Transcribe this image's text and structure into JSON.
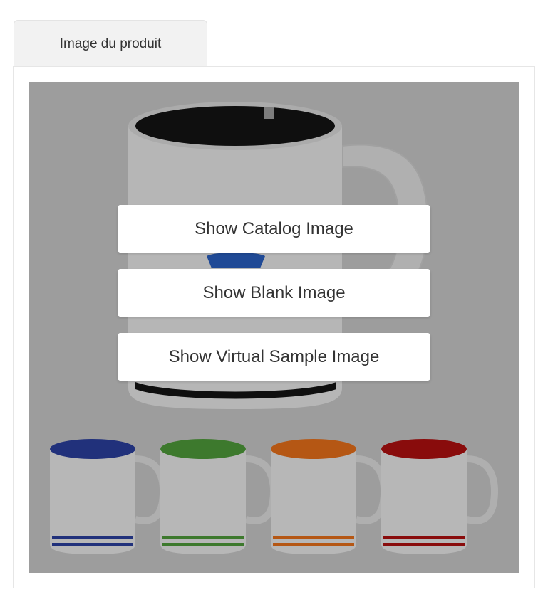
{
  "tab": {
    "label": "Image du produit"
  },
  "buttons": {
    "catalog": "Show Catalog Image",
    "blank": "Show Blank Image",
    "virtual": "Show Virtual Sample Image"
  },
  "colors": {
    "mug_body": "#e6e6e6",
    "main_interior": "#111111",
    "logo": "#2a5fc0",
    "variant_blue": "#2b3f9e",
    "variant_green": "#4f9b3a",
    "variant_orange": "#e8701a",
    "variant_red": "#b01010"
  },
  "icons": {
    "product_photo": "mug-product-photo"
  }
}
